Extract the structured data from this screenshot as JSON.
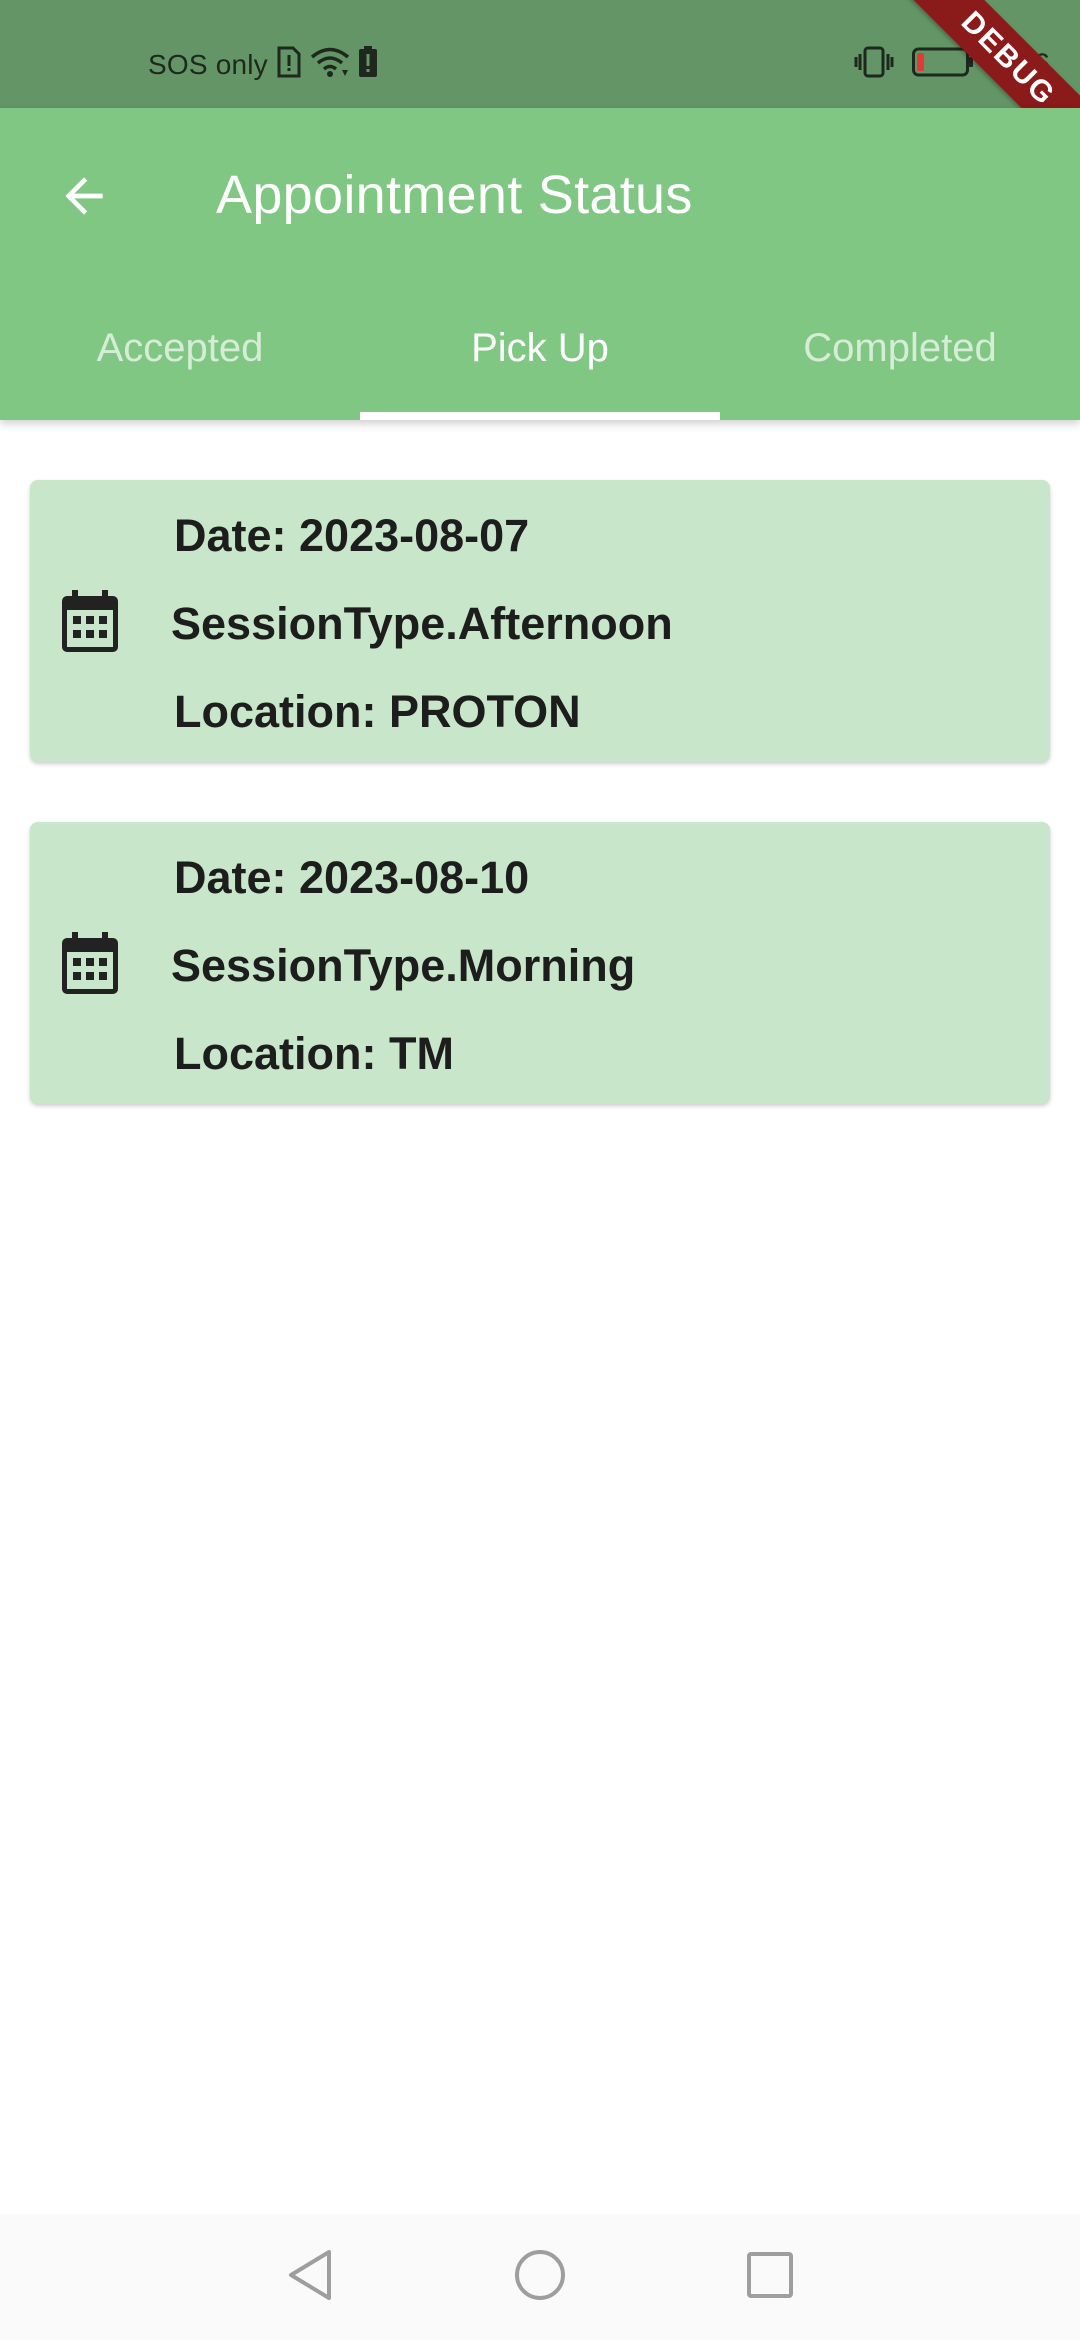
{
  "status_bar": {
    "carrier": "SOS only",
    "time": "3:56",
    "icons": [
      "sim-alert-icon",
      "wifi-icon",
      "battery-saver-icon",
      "vibrate-icon",
      "battery-icon"
    ],
    "battery_level_pct": 15
  },
  "app_bar": {
    "title": "Appointment Status",
    "back_icon": "arrow-back-icon"
  },
  "tabs": [
    {
      "label": "Accepted",
      "selected": false
    },
    {
      "label": "Pick Up",
      "selected": true
    },
    {
      "label": "Completed",
      "selected": false
    }
  ],
  "appointments": [
    {
      "icon": "calendar-icon",
      "date": "Date: 2023-08-07",
      "session": "SessionType.Afternoon",
      "location": "Location: PROTON"
    },
    {
      "icon": "calendar-icon",
      "date": "Date: 2023-08-10",
      "session": "SessionType.Morning",
      "location": "Location: TM"
    }
  ],
  "debug_banner": "DEBUG",
  "nav_bar": {
    "icons": [
      "back-triangle-icon",
      "home-circle-icon",
      "recents-square-icon"
    ]
  },
  "colors": {
    "status_bar": "#639566",
    "app_bar": "#81c784",
    "card": "#c8e6c9",
    "tab_inactive": "#d5ecd6",
    "debug": "#8b1a1a"
  }
}
